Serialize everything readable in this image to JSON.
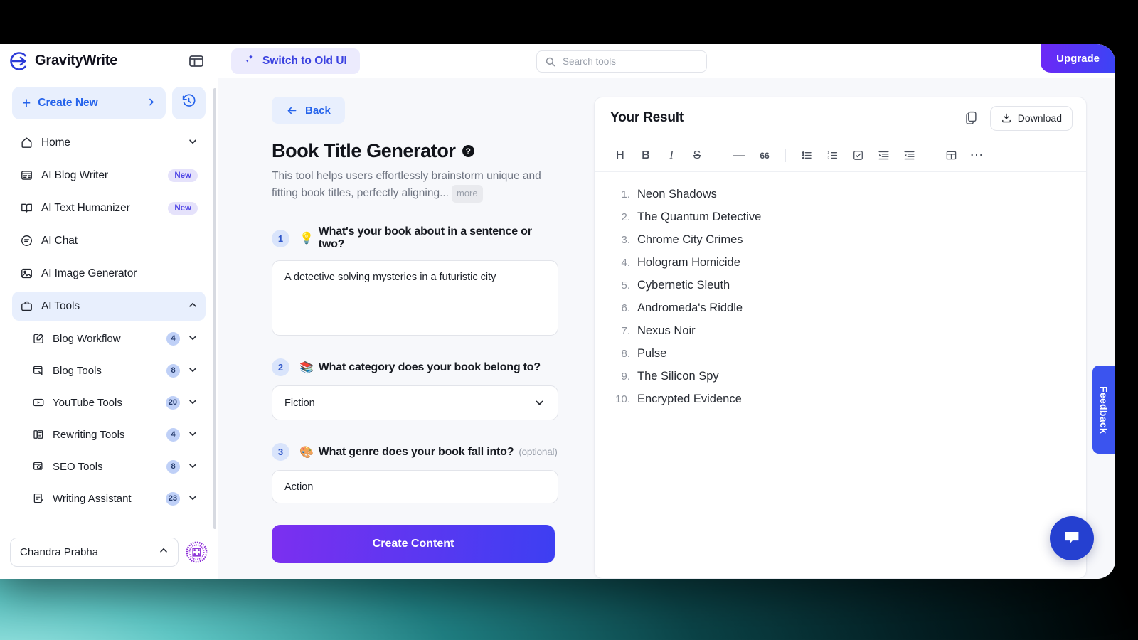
{
  "brand": {
    "name": "GravityWrite",
    "logo_icon": "gravity-logo-icon",
    "panel_toggle_icon": "panel-toggle-icon"
  },
  "sidebar": {
    "create_new": {
      "label": "Create New",
      "plus_icon": "plus-icon",
      "chevron_icon": "chevron-right-icon"
    },
    "history_icon": "history-clock-icon",
    "nav": [
      {
        "label": "Home",
        "icon": "home-icon",
        "chevron": "chevron-down-icon",
        "badge": "",
        "active": false
      },
      {
        "label": "AI Blog Writer",
        "icon": "article-icon",
        "chevron": "",
        "badge": "New",
        "active": false
      },
      {
        "label": "AI Text Humanizer",
        "icon": "book-icon",
        "chevron": "",
        "badge": "New",
        "active": false
      },
      {
        "label": "AI Chat",
        "icon": "chat-bubble-icon",
        "chevron": "",
        "badge": "",
        "active": false
      },
      {
        "label": "AI Image Generator",
        "icon": "image-icon",
        "chevron": "",
        "badge": "",
        "active": false
      },
      {
        "label": "AI Tools",
        "icon": "toolbox-icon",
        "chevron": "chevron-up-icon",
        "badge": "",
        "active": true
      }
    ],
    "sub_nav": [
      {
        "label": "Blog Workflow",
        "icon": "pencil-square-icon",
        "count": "4"
      },
      {
        "label": "Blog Tools",
        "icon": "blog-tools-icon",
        "count": "8"
      },
      {
        "label": "YouTube Tools",
        "icon": "youtube-play-icon",
        "count": "20"
      },
      {
        "label": "Rewriting Tools",
        "icon": "rewrite-icon",
        "count": "4"
      },
      {
        "label": "SEO Tools",
        "icon": "seo-search-icon",
        "count": "8"
      },
      {
        "label": "Writing Assistant",
        "icon": "writing-assistant-icon",
        "count": "23"
      }
    ],
    "user": {
      "name": "Chandra Prabha",
      "chevron_icon": "chevron-up-icon",
      "avatar_icon": "user-avatar"
    }
  },
  "topbar": {
    "switch_ui": {
      "label": "Switch to Old UI",
      "icon": "sparkle-icon"
    },
    "search": {
      "placeholder": "Search tools",
      "value": "",
      "icon": "search-icon"
    },
    "upgrade_label": "Upgrade"
  },
  "form": {
    "back_label": "Back",
    "back_icon": "arrow-left-icon",
    "title": "Book Title Generator",
    "help_icon": "question-mark-icon",
    "description": "This tool helps users effortlessly brainstorm unique and fitting book titles, perfectly aligning...",
    "more_label": "more",
    "questions": [
      {
        "number": "1",
        "emoji": "💡",
        "label": "What's your book about in a sentence or two?",
        "optional": "",
        "type": "textarea",
        "value": "A detective solving mysteries in a futuristic city",
        "placeholder": ""
      },
      {
        "number": "2",
        "emoji": "📚",
        "label": "What category does your book belong to?",
        "optional": "",
        "type": "select",
        "value": "Fiction",
        "placeholder": ""
      },
      {
        "number": "3",
        "emoji": "🎨",
        "label": "What genre does your book fall into?",
        "optional": "(optional)",
        "type": "input",
        "value": "Action",
        "placeholder": ""
      }
    ],
    "submit_label": "Create Content"
  },
  "result": {
    "title": "Your Result",
    "copy_icon": "copy-icon",
    "download": {
      "label": "Download",
      "icon": "download-icon"
    },
    "toolbar": [
      {
        "name": "heading-tool",
        "glyph": "H"
      },
      {
        "name": "bold-tool",
        "glyph": "B"
      },
      {
        "name": "italic-tool",
        "glyph": "I"
      },
      {
        "name": "strikethrough-tool",
        "glyph": "S"
      },
      {
        "name": "separator-1",
        "glyph": "|"
      },
      {
        "name": "horizontal-rule-tool",
        "glyph": "—"
      },
      {
        "name": "blockquote-tool",
        "glyph": "66"
      },
      {
        "name": "separator-2",
        "glyph": "|"
      },
      {
        "name": "bullet-list-tool",
        "glyph": "ul"
      },
      {
        "name": "numbered-list-tool",
        "glyph": "ol"
      },
      {
        "name": "checklist-tool",
        "glyph": "check"
      },
      {
        "name": "indent-increase-tool",
        "glyph": "indent"
      },
      {
        "name": "indent-decrease-tool",
        "glyph": "outdent"
      },
      {
        "name": "separator-3",
        "glyph": "|"
      },
      {
        "name": "table-tool",
        "glyph": "table"
      },
      {
        "name": "more-options-tool",
        "glyph": "⋯"
      }
    ],
    "items": [
      {
        "index": "1.",
        "text": "Neon Shadows"
      },
      {
        "index": "2.",
        "text": "The Quantum Detective"
      },
      {
        "index": "3.",
        "text": "Chrome City Crimes"
      },
      {
        "index": "4.",
        "text": "Hologram Homicide"
      },
      {
        "index": "5.",
        "text": "Cybernetic Sleuth"
      },
      {
        "index": "6.",
        "text": "Andromeda's Riddle"
      },
      {
        "index": "7.",
        "text": "Nexus Noir"
      },
      {
        "index": "8.",
        "text": "Pulse"
      },
      {
        "index": "9.",
        "text": "The Silicon Spy"
      },
      {
        "index": "10.",
        "text": "Encrypted Evidence"
      }
    ]
  },
  "floating": {
    "feedback_label": "Feedback",
    "chat_icon": "chat-icon"
  },
  "colors": {
    "accent_blue": "#2563eb",
    "accent_indigo": "#3b44f5",
    "accent_purple": "#7c2ff0",
    "badge_new_bg": "#e5e2fb",
    "background_teal": "#0d5a5c"
  }
}
